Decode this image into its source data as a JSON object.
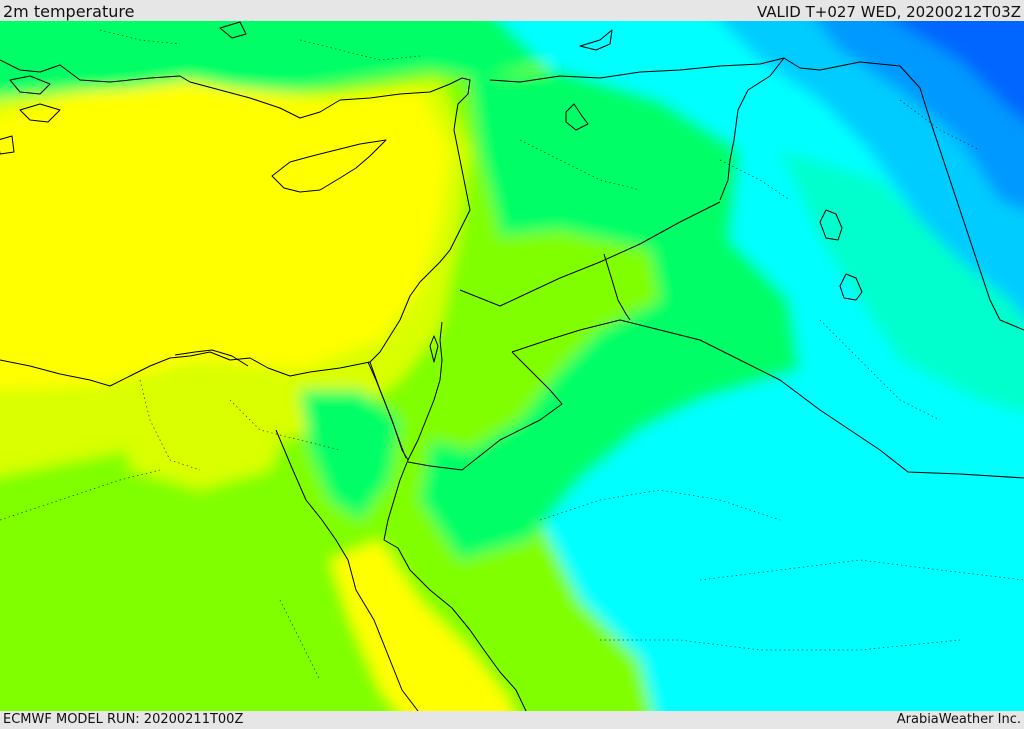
{
  "header": {
    "title": "2m temperature",
    "valid": "VALID T+027 WED, 20200212T03Z"
  },
  "footer": {
    "model_run": "ECMWF MODEL RUN: 20200211T00Z",
    "credit": "ArabiaWeather Inc."
  },
  "colors": {
    "frame_bg": "#e6e6e6",
    "warm_yellow": "#ffff00",
    "yellow_green": "#d9ff00",
    "lime": "#80ff00",
    "green": "#00ff66",
    "aqua_green": "#00ffcc",
    "cyan": "#00ffff",
    "light_blue": "#00ccff",
    "blue": "#0099ff",
    "deep_blue": "#0066ff",
    "border_line": "#000000"
  }
}
